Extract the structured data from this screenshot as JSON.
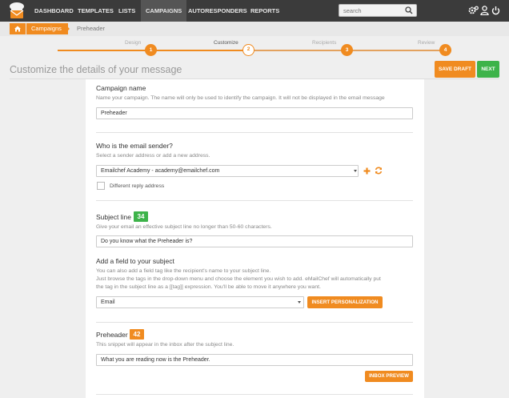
{
  "nav": {
    "items": [
      "DASHBOARD",
      "TEMPLATES",
      "LISTS",
      "CAMPAIGNS",
      "AUTORESPONDERS",
      "REPORTS"
    ],
    "active": "CAMPAIGNS",
    "search_placeholder": "search"
  },
  "breadcrumb": {
    "parent": "Campaigns",
    "current": "Preheader"
  },
  "steps": [
    {
      "num": "1",
      "label": "Design"
    },
    {
      "num": "2",
      "label": "Customize"
    },
    {
      "num": "3",
      "label": "Recipients"
    },
    {
      "num": "4",
      "label": "Review"
    }
  ],
  "page": {
    "title": "Customize the details of your message",
    "save_draft": "SAVE DRAFT",
    "next": "NEXT"
  },
  "form": {
    "campaign_name": {
      "label": "Campaign name",
      "help": "Name your campaign. The name will only be used to identify the campaign. It will not be displayed in the email message",
      "value": "Preheader"
    },
    "sender": {
      "label": "Who is the email sender?",
      "help": "Select a sender address or add a new address.",
      "value": "Emailchef Academy - academy@emailchef.com",
      "reply_label": "Different reply address"
    },
    "subject": {
      "label": "Subject line",
      "count": "34",
      "help": "Give your email an effective subject line no longer than 50-60 characters.",
      "value": "Do you know what the Preheader is?"
    },
    "field_tag": {
      "label": "Add a field to your subject",
      "help1": "You can also add a field tag like the recipient's name to your subject line.",
      "help2": "Just browse the tags in the drop-down menu and choose the element you wish to add. eMailChef will automatically put",
      "help3": "the tag in the subject line as a [[tag]] expression. You'll be able to move it anywhere you want.",
      "value": "Email",
      "button": "INSERT PERSONALIZATION"
    },
    "preheader": {
      "label": "Preheader",
      "count": "42",
      "help": "This snippet will appear in the inbox after the subject line.",
      "value": "What you are reading now is the Preheader.",
      "button": "INBOX PREVIEW"
    }
  },
  "colors": {
    "accent": "#f08b20",
    "success": "#3db34a",
    "nav_bg": "#3b3b3b"
  }
}
